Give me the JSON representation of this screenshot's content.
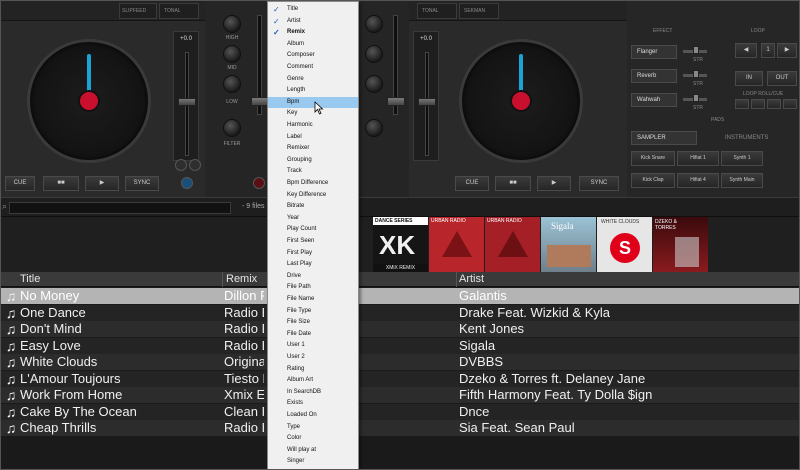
{
  "deck_left": {
    "tabs": [
      "SLIPFEED",
      "TONAL"
    ],
    "pitch_value": "+0.0",
    "buttons": {
      "cue": "CUE",
      "pause": "■■",
      "play": "▶",
      "sync": "SYNC"
    }
  },
  "mixer": {
    "knob_labels": {
      "high": "HIGH",
      "mid": "MID",
      "low": "LOW",
      "filter": "FILTER"
    }
  },
  "deck_right": {
    "tabs": [
      "TONAL",
      "SEKMAN"
    ],
    "pitch_value": "+0.0",
    "buttons": {
      "cue": "CUE",
      "pause": "■■",
      "play": "▶",
      "sync": "SYNC"
    }
  },
  "effects": {
    "title": "EFFECT",
    "items": [
      {
        "name": "Flanger",
        "value": "STR"
      },
      {
        "name": "Reverb",
        "value": "STR"
      },
      {
        "name": "Wahwah",
        "value": "STR"
      }
    ]
  },
  "loop": {
    "title": "LOOP",
    "in_label": "IN",
    "out_label": "OUT",
    "roll_label": "LOOP ROLL/CUE"
  },
  "pads": {
    "title": "PADS"
  },
  "sampler": {
    "dropdown": "SAMPLER",
    "category": "INSTRUMENTS",
    "pads": [
      "Kick Snare",
      "Hifiat 1",
      "Synth 1",
      "Kick Clap",
      "Hifiat 4",
      "Synth Main"
    ]
  },
  "browser": {
    "search_placeholder": "",
    "files_count": "- 9 files -"
  },
  "covers": [
    {
      "name": "dance-series-cover",
      "text": "DANCE SERIES",
      "sub": "XMiX REMIX",
      "bg": "#e8e8e8"
    },
    {
      "name": "urban-radio-cover-1",
      "text": "URBAN RADIO",
      "sub": "",
      "bg": "#b8262b"
    },
    {
      "name": "urban-radio-cover-2",
      "text": "URBAN RADIO",
      "sub": "",
      "bg": "#a51f26"
    },
    {
      "name": "sigala-cover",
      "text": "Sigala",
      "sub": "",
      "bg": "#8cb4c8"
    },
    {
      "name": "white-clouds-cover",
      "text": "WHITE CLOUDS",
      "sub": "",
      "bg": "#e6e6e6"
    },
    {
      "name": "dzeko-torres-cover",
      "text": "DZEKO & TORRES",
      "sub": "",
      "bg": "#6e1518"
    }
  ],
  "table": {
    "columns": {
      "title": "Title",
      "remix": "Remix",
      "artist": "Artist"
    },
    "rows": [
      {
        "title": "No Money",
        "remix": "Dillon F",
        "artist": "Galantis",
        "selected": true
      },
      {
        "title": "One Dance",
        "remix": "Radio E",
        "artist": "Drake Feat. Wizkid & Kyla"
      },
      {
        "title": "Don't Mind",
        "remix": "Radio E",
        "artist": "Kent Jones"
      },
      {
        "title": "Easy Love",
        "remix": "Radio E",
        "artist": "Sigala"
      },
      {
        "title": "White Clouds",
        "remix": "Origina",
        "artist": "DVBBS"
      },
      {
        "title": "L'Amour Toujours",
        "remix": "Tiesto E",
        "artist": "Dzeko & Torres ft. Delaney Jane"
      },
      {
        "title": "Work From Home",
        "remix": "Xmix E",
        "artist": "Fifth Harmony Feat. Ty Dolla $ign"
      },
      {
        "title": "Cake By The Ocean",
        "remix": "Clean F",
        "artist": "Dnce"
      },
      {
        "title": "Cheap Thrills",
        "remix": "Radio E",
        "artist": "Sia Feat. Sean Paul"
      }
    ]
  },
  "context_menu": {
    "items": [
      {
        "label": "Title",
        "checked": true
      },
      {
        "label": "Artist",
        "checked": true
      },
      {
        "label": "Remix",
        "checked": true,
        "bold": true
      },
      {
        "label": "Album"
      },
      {
        "label": "Composer"
      },
      {
        "label": "Comment"
      },
      {
        "label": "Genre"
      },
      {
        "label": "Length"
      },
      {
        "label": "Bpm",
        "highlighted": true
      },
      {
        "label": "Key"
      },
      {
        "label": "Harmonic"
      },
      {
        "label": "Label"
      },
      {
        "label": "Remixer"
      },
      {
        "label": "Grouping"
      },
      {
        "label": "Track"
      },
      {
        "label": "Bpm Difference"
      },
      {
        "label": "Key Difference"
      },
      {
        "label": "Bitrate"
      },
      {
        "label": "Year"
      },
      {
        "label": "Play Count"
      },
      {
        "label": "First Seen"
      },
      {
        "label": "First Play"
      },
      {
        "label": "Last Play"
      },
      {
        "label": "Drive"
      },
      {
        "label": "File Path"
      },
      {
        "label": "File Name"
      },
      {
        "label": "File Type"
      },
      {
        "label": "File Size"
      },
      {
        "label": "File Date"
      },
      {
        "label": "User 1"
      },
      {
        "label": "User 2"
      },
      {
        "label": "Rating"
      },
      {
        "label": "Album Art"
      },
      {
        "label": "In SearchDB"
      },
      {
        "label": "Exists"
      },
      {
        "label": "Loaded On"
      },
      {
        "label": "Type"
      },
      {
        "label": "Color"
      },
      {
        "label": "Will play at"
      },
      {
        "label": "Singer"
      }
    ]
  },
  "colors": {
    "accent": "#1aa3d6",
    "jog_center": "#c8102e",
    "menu_highlight": "#99c9ef",
    "selected_row": "#b4b4b4"
  }
}
